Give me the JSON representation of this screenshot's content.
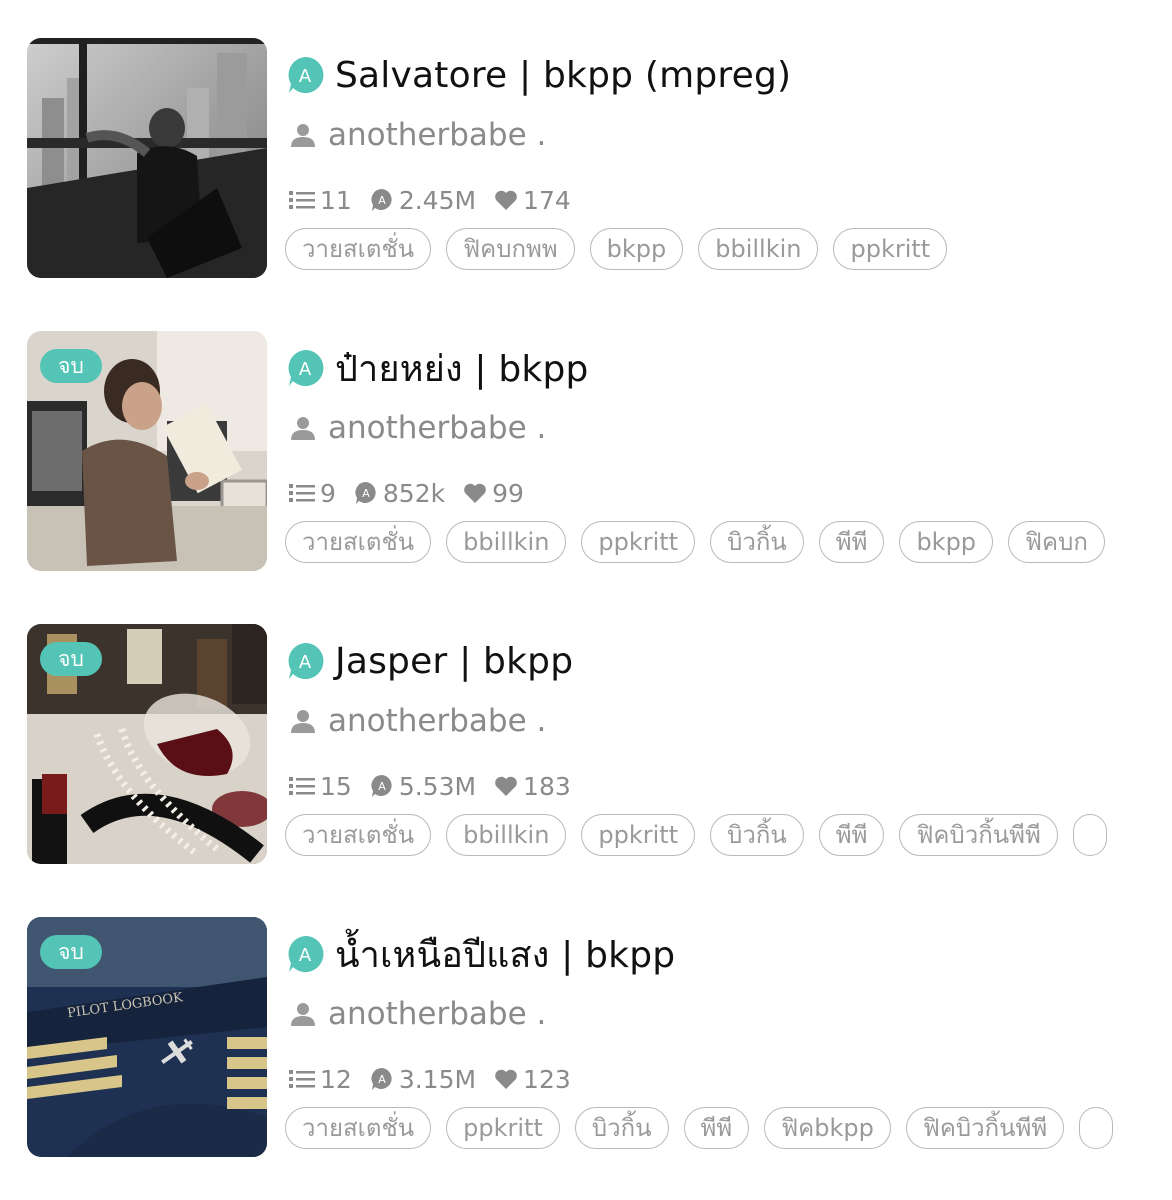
{
  "colors": {
    "accent": "#53c4b5",
    "muted_text": "#8a8a8a",
    "tag_border": "#b9b9b9"
  },
  "stories": [
    {
      "title": "Salvatore | bkpp (mpreg)",
      "author": "anotherbabe .",
      "chapters": "11",
      "views": "2.45M",
      "likes": "174",
      "completed_badge": "",
      "tags": [
        "วายสเตชั่น",
        "ฟิคบกพพ",
        "bkpp",
        "bbillkin",
        "ppkritt"
      ]
    },
    {
      "title": "ป๋ายหย่ง | bkpp",
      "author": "anotherbabe .",
      "chapters": "9",
      "views": "852k",
      "likes": "99",
      "completed_badge": "จบ",
      "tags": [
        "วายสเตชั่น",
        "bbillkin",
        "ppkritt",
        "บิวกิ้น",
        "พีพี",
        "bkpp",
        "ฟิคบก"
      ]
    },
    {
      "title": "Jasper | bkpp",
      "author": "anotherbabe .",
      "chapters": "15",
      "views": "5.53M",
      "likes": "183",
      "completed_badge": "จบ",
      "tags": [
        "วายสเตชั่น",
        "bbillkin",
        "ppkritt",
        "บิวกิ้น",
        "พีพี",
        "ฟิคบิวกิ้นพีพี",
        ""
      ]
    },
    {
      "title": "น้ำเหนือปีแสง | bkpp",
      "author": "anotherbabe .",
      "chapters": "12",
      "views": "3.15M",
      "likes": "123",
      "completed_badge": "จบ",
      "cover_text": "PILOT LOGBOOK",
      "tags": [
        "วายสเตชั่น",
        "ppkritt",
        "บิวกิ้น",
        "พีพี",
        "ฟิคbkpp",
        "ฟิคบิวกิ้นพีพี",
        ""
      ]
    }
  ]
}
